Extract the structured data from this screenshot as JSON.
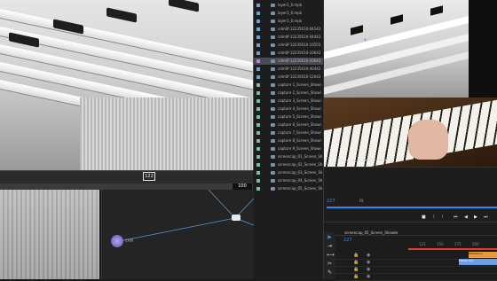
{
  "viewport": {
    "frame_tag": "122",
    "value_readout": "100"
  },
  "node_editor": {
    "node_label": "CAM"
  },
  "project_panel": {
    "items": [
      {
        "label": "layer1_0.mpk",
        "color": "#6aa3d8",
        "selected": false
      },
      {
        "label": "layer1_0.mpk",
        "color": "#6aa3d8",
        "selected": false
      },
      {
        "label": "layer1_0.mpk",
        "color": "#6aa3d8",
        "selected": false
      },
      {
        "label": "cdm0f-12235610-04143",
        "color": "#6aa3d8",
        "selected": false
      },
      {
        "label": "cdm0f-12235610-04443",
        "color": "#6aa3d8",
        "selected": false
      },
      {
        "label": "cdm0f-12235610-10553",
        "color": "#6aa3d8",
        "selected": false
      },
      {
        "label": "cdm0f-12235610-10643",
        "color": "#6aa3d8",
        "selected": false
      },
      {
        "label": "cdm0f-12235610-10643",
        "color": "#a78bd6",
        "selected": true
      },
      {
        "label": "cdm0f-12235610-40443",
        "color": "#6aa3d8",
        "selected": false
      },
      {
        "label": "cdm0f-12235610-12043",
        "color": "#6aa3d8",
        "selected": false
      },
      {
        "label": "capture 1_Screen_Showi",
        "color": "#6fc3a0",
        "selected": false
      },
      {
        "label": "capture 2_Screen_Showi",
        "color": "#6fc3a0",
        "selected": false
      },
      {
        "label": "capture 3_Screen_Showi",
        "color": "#6fc3a0",
        "selected": false
      },
      {
        "label": "capture 4_Screen_Showi",
        "color": "#6fc3a0",
        "selected": false
      },
      {
        "label": "capture 5_Screen_Showi",
        "color": "#6fc3a0",
        "selected": false
      },
      {
        "label": "capture 6_Screen_Showi",
        "color": "#6fc3a0",
        "selected": false
      },
      {
        "label": "capture 7_Screen_Showi",
        "color": "#6fc3a0",
        "selected": false
      },
      {
        "label": "capture 8_Screen_Showi",
        "color": "#6fc3a0",
        "selected": false
      },
      {
        "label": "capture 9_Screen_Showi",
        "color": "#6fc3a0",
        "selected": false
      },
      {
        "label": "screencap_01_Screen_Sh",
        "color": "#6fc3a0",
        "selected": false
      },
      {
        "label": "screencap_02_Screen_Sh",
        "color": "#6fc3a0",
        "selected": false
      },
      {
        "label": "screencap_03_Screen_Sh",
        "color": "#6fc3a0",
        "selected": false
      },
      {
        "label": "screencap_04_Screen_Sh",
        "color": "#6fc3a0",
        "selected": false
      },
      {
        "label": "screencap_05_Screen_Sh",
        "color": "#6fc3a0",
        "selected": false
      }
    ]
  },
  "monitor": {
    "clip_label": "screencap_05_Screen_Showin..."
  },
  "timeline": {
    "timecode": "227",
    "zoom": "Fit",
    "sequence_name": "screencap_05_Screen_Showin",
    "current_frame": "227",
    "ruler": [
      "125",
      "150",
      "175",
      "200"
    ],
    "clip_a": "MIDI/Piano",
    "clip_b": "Master Mix"
  },
  "colors": {
    "accent": "#2d8cf0",
    "playhead": "#e23c2e"
  }
}
